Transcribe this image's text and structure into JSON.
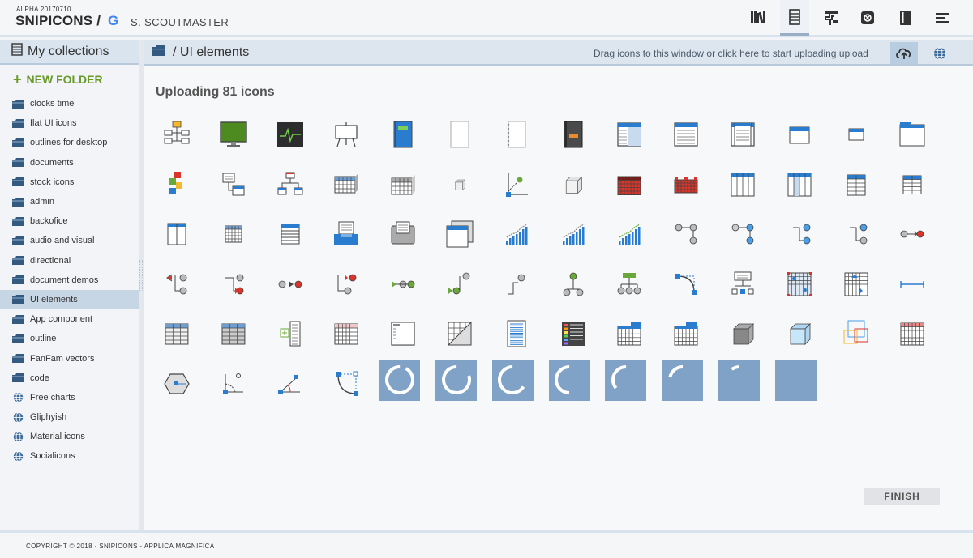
{
  "header": {
    "version": "ALPHA 20170710",
    "brand": "SNIPICONS /",
    "google_glyph": "G",
    "user": "S. SCOUTMASTER",
    "nav_icons": [
      "library-icon",
      "collection-icon",
      "ci-icon",
      "package-icon",
      "notebook-icon",
      "menu-icon"
    ],
    "active_nav": 1
  },
  "sidebar": {
    "title": "My collections",
    "new_folder": "NEW FOLDER",
    "items": [
      {
        "label": "clocks time",
        "icon": "folder-icon"
      },
      {
        "label": "flat UI icons",
        "icon": "folder-icon"
      },
      {
        "label": "outlines for desktop",
        "icon": "folder-icon"
      },
      {
        "label": "documents",
        "icon": "folder-icon"
      },
      {
        "label": "stock icons",
        "icon": "folder-icon"
      },
      {
        "label": "admin",
        "icon": "folder-icon"
      },
      {
        "label": "backofice",
        "icon": "folder-icon"
      },
      {
        "label": "audio and visual",
        "icon": "folder-icon"
      },
      {
        "label": "directional",
        "icon": "folder-icon"
      },
      {
        "label": "document demos",
        "icon": "folder-icon"
      },
      {
        "label": "UI elements",
        "icon": "folder-icon",
        "active": true
      },
      {
        "label": "App component",
        "icon": "folder-icon"
      },
      {
        "label": "outline",
        "icon": "folder-icon"
      },
      {
        "label": "FanFam vectors",
        "icon": "folder-icon"
      },
      {
        "label": "code",
        "icon": "folder-icon"
      },
      {
        "label": "Free charts",
        "icon": "globe-icon"
      },
      {
        "label": "Gliphyish",
        "icon": "globe-icon"
      },
      {
        "label": "Material icons",
        "icon": "globe-icon"
      },
      {
        "label": "Socialicons",
        "icon": "globe-icon"
      }
    ]
  },
  "main": {
    "breadcrumb": "/ UI elements",
    "upload_hint": "Drag icons to this window or click here to start uploading upload",
    "upload_title": "Uploading 81 icons",
    "finish": "FINISH",
    "icon_rows": [
      [
        "sitemap-icon",
        "monitor-green-icon",
        "oscilloscope-icon",
        "presentation-board-icon",
        "blue-notebook-icon",
        "blank-page-icon",
        "spiral-page-icon",
        "dark-notebook-icon",
        "window-sidebar-icon",
        "window-text-icon",
        "window-list-icon",
        "small-window-icon",
        "tiny-window-icon",
        "folder-window-icon"
      ],
      [
        "puzzle-blocks-icon",
        "window-link-icon",
        "hierarchy-icon",
        "table-3d-blue-icon",
        "table-3d-gray-icon",
        "cube-small-icon",
        "axis-node-icon",
        "cube-stack-icon",
        "table-red-icon",
        "red-blocks-icon",
        "columns-icon",
        "columns-highlight-icon",
        "table-header-icon",
        "table-header-alt-icon"
      ],
      [
        "two-column-icon",
        "small-grid-icon",
        "list-rows-icon",
        "inbox-blue-icon",
        "fax-icon",
        "window-stack-icon",
        "bar-chart-rising-icon",
        "bar-trend-icon",
        "bar-trend-green-icon",
        "gray-nodes-icon",
        "blue-nodes-icon",
        "node-link-blue-icon",
        "node-link-mixed-icon",
        "arrow-join-red-icon"
      ],
      [
        "arrow-left-red-icon",
        "arrow-right-red-icon",
        "arrow-node-red-icon",
        "arrow-branch-red-icon",
        "arrow-green-icon",
        "arrow-branch-green-icon",
        "step-node-icon",
        "fork-green-icon",
        "tree-green-icon",
        "curve-blue-icon",
        "org-chart-icon",
        "grid-dots-icon",
        "grid-arrows-icon",
        "dimension-icon"
      ],
      [
        "table-striped-icon",
        "table-dark-header-icon",
        "form-tree-icon",
        "table-pink-icon",
        "window-doc-icon",
        "triangle-grid-icon",
        "notepad-lines-icon",
        "color-stack-icon",
        "calendar-blue-icon",
        "calendar-blue-alt-icon",
        "cube-gray-icon",
        "cube-blue-icon",
        "wireframe-cubes-icon",
        "calendar-red-icon"
      ],
      [
        "hexagon-node-icon",
        "angle-circle-icon",
        "angle-red-icon",
        "curve-handles-icon"
      ]
    ],
    "spinner_progress": [
      0.92,
      0.8,
      0.66,
      0.5,
      0.36,
      0.22,
      0.1,
      0
    ]
  },
  "footer": {
    "copyright": "COPYRIGHT © 2018 - SNIPICONS - APPLICA MAGNIFICA"
  },
  "colors": {
    "accent_blue": "#2a7ccf",
    "green": "#6a9a2a",
    "spinner_bg": "#7fa2c6",
    "active_row": "#c7d6e5"
  }
}
